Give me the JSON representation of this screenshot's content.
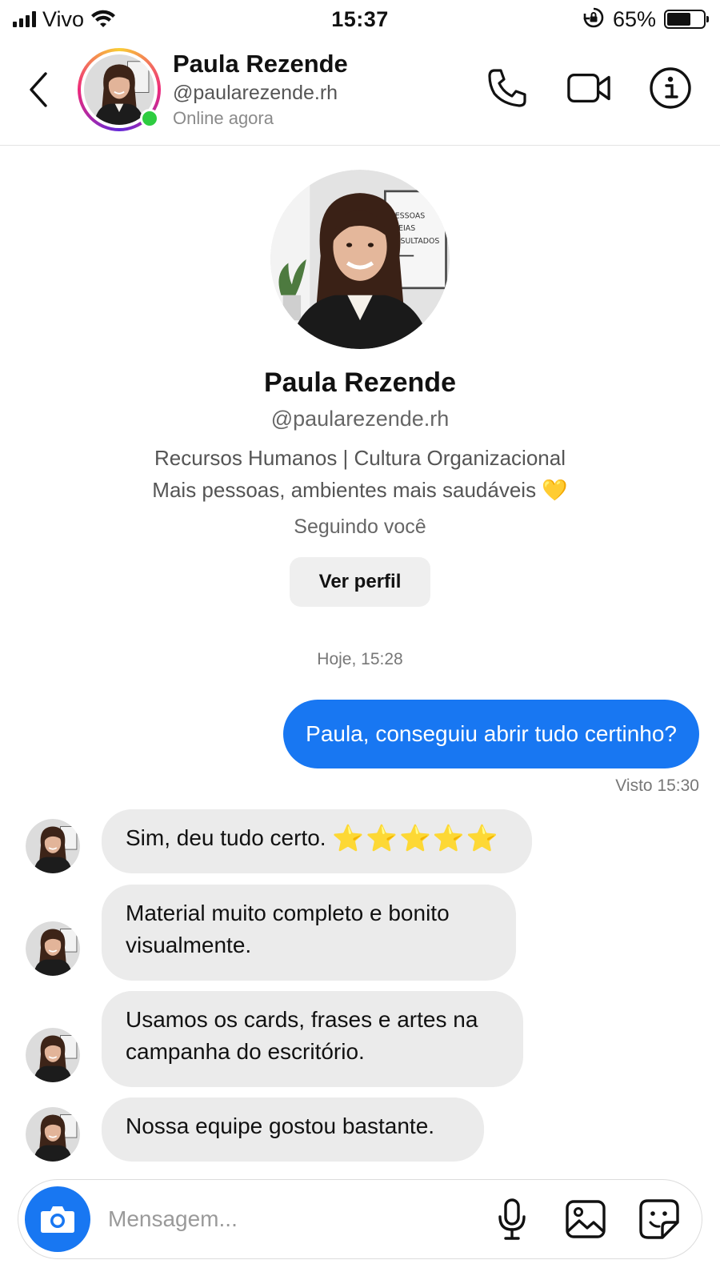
{
  "status_bar": {
    "carrier": "Vivo",
    "time": "15:37",
    "battery_percent": "65%",
    "battery_level": 0.65
  },
  "header": {
    "name": "Paula Rezende",
    "handle": "@paularezende.rh",
    "status": "Online agora",
    "icons": [
      "chevron-left-icon",
      "phone-icon",
      "video-icon",
      "info-icon"
    ]
  },
  "profile": {
    "name": "Paula Rezende",
    "handle": "@paularezende.rh",
    "bio_line1": "Recursos Humanos | Cultura Organizacional",
    "bio_line2": "Mais pessoas, ambientes mais saudáveis 💛",
    "following": "Seguindo você",
    "view_profile_label": "Ver perfil",
    "poster_lines": [
      "PESSOAS",
      "IDEIAS",
      "RESULTADOS"
    ]
  },
  "chat": {
    "timestamp": "Hoje, 15:28",
    "outgoing": [
      {
        "text": "Paula, conseguiu abrir tudo certinho?"
      }
    ],
    "seen": "Visto 15:30",
    "incoming": [
      {
        "text": "Sim, deu tudo certo.",
        "stars": "⭐⭐⭐⭐⭐"
      },
      {
        "text": "Material muito completo e bonito\nvisualmente."
      },
      {
        "text": "Usamos os cards, frases e artes na\ncampanha do escritório."
      },
      {
        "text": "Nossa equipe gostou bastante."
      }
    ]
  },
  "composer": {
    "placeholder": "Mensagem...",
    "icons": [
      "camera-icon",
      "microphone-icon",
      "image-icon",
      "sticker-icon"
    ]
  },
  "colors": {
    "accent": "#1877f2",
    "incoming_bubble": "#ebebeb",
    "online": "#2ecc40"
  }
}
